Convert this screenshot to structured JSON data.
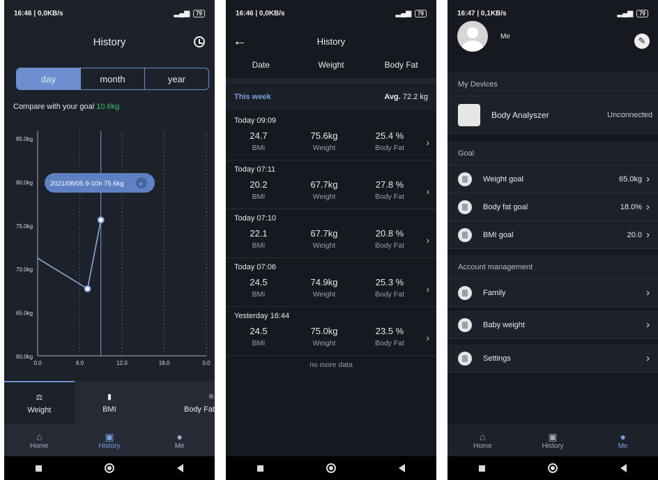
{
  "p1": {
    "status": {
      "time": "16:46 | 0,0KB/s",
      "battery": "79"
    },
    "title": "History",
    "segments": [
      "day",
      "month",
      "year"
    ],
    "compare_label": "Compare with your goal",
    "compare_value": "10.6kg",
    "tooltip": "2021/08/05 9-10h 75.6kg",
    "metrics": [
      "Weight",
      "BMI",
      "Body Fat"
    ],
    "tabs": [
      "Home",
      "History",
      "Me"
    ]
  },
  "chart_data": {
    "type": "line",
    "yticks": [
      "85.0kg",
      "80.0kg",
      "75.0kg",
      "70.0kg",
      "65.0kg",
      "60.0kg"
    ],
    "xticks": [
      "0.0",
      "6.0",
      "12.0",
      "18.0",
      "0.0"
    ],
    "ylim": [
      60,
      85
    ],
    "xlim": [
      0,
      24
    ],
    "grid": true,
    "series": [
      {
        "values": [
          {
            "x": 0,
            "y": 71.2
          },
          {
            "x": 7.1,
            "y": 67.7
          },
          {
            "x": 9.0,
            "y": 75.6
          }
        ]
      }
    ],
    "highlight_x": 9.0
  },
  "p2": {
    "status": {
      "time": "16:46 | 0,0KB/s",
      "battery": "79"
    },
    "title": "History",
    "cols": [
      "Date",
      "Weight",
      "Body Fat"
    ],
    "week_label": "This week",
    "avg_label": "Avg.",
    "avg_value": "72.2 kg",
    "records": [
      {
        "time": "Today 09:09",
        "bmi": "24.7",
        "weight": "75.6kg",
        "fat": "25.4 %"
      },
      {
        "time": "Today 07:11",
        "bmi": "20.2",
        "weight": "67.7kg",
        "fat": "27.8 %"
      },
      {
        "time": "Today 07:10",
        "bmi": "22.1",
        "weight": "67.7kg",
        "fat": "20.8 %"
      },
      {
        "time": "Today 07:06",
        "bmi": "24.5",
        "weight": "74.9kg",
        "fat": "25.3 %"
      },
      {
        "time": "Yesterday 16:44",
        "bmi": "24.5",
        "weight": "75.0kg",
        "fat": "23.5 %"
      }
    ],
    "k_bmi": "BMI",
    "k_weight": "Weight",
    "k_fat": "Body Fat",
    "no_more": "no more data"
  },
  "p3": {
    "status": {
      "time": "16:47 | 0,1KB/s",
      "battery": "79"
    },
    "name": "Me",
    "devices_header": "My Devices",
    "device_name": "Body Analyszer",
    "device_status": "Unconnected",
    "goal_header": "Goal",
    "goals": [
      {
        "label": "Weight goal",
        "value": "65.0kg"
      },
      {
        "label": "Body fat goal",
        "value": "18.0%"
      },
      {
        "label": "BMI goal",
        "value": "20.0"
      }
    ],
    "account_header": "Account management",
    "family": "Family",
    "baby": "Baby weight",
    "settings": "Settings",
    "tabs": [
      "Home",
      "History",
      "Me"
    ]
  }
}
